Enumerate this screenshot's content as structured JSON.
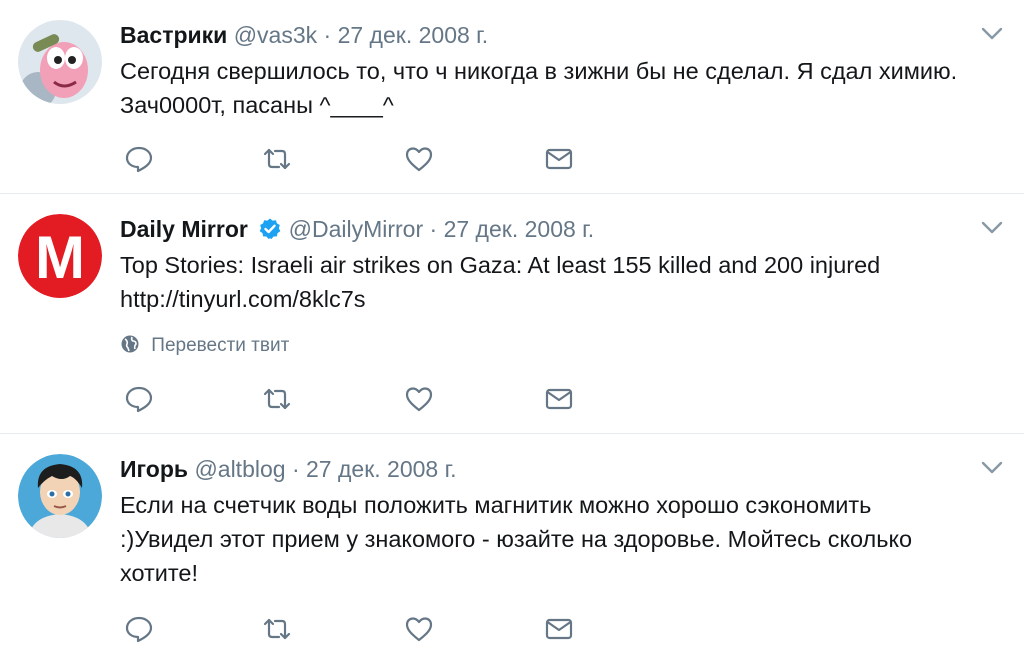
{
  "tweets": [
    {
      "name": "Вастрики",
      "handle": "@vas3k",
      "separator": "·",
      "date": "27 дек. 2008 г.",
      "text": "Сегодня свершилось то, что ч никогда в зижни бы не сделал. Я сдал химию. Зач0000т, пасаны ^____^",
      "avatar_icon": "cartoon-worm-avatar"
    },
    {
      "name": "Daily Mirror",
      "verified": true,
      "handle": "@DailyMirror",
      "separator": "·",
      "date": "27 дек. 2008 г.",
      "text": "Top Stories: Israeli air strikes on Gaza: At least 155 killed and 200 injured http://tinyurl.com/8klc7s",
      "translate_label": "Перевести твит",
      "avatar_icon": "daily-mirror-logo",
      "avatar_letter": "M"
    },
    {
      "name": "Игорь",
      "handle": "@altblog",
      "separator": "·",
      "date": "27 дек. 2008 г.",
      "text": "Если на счетчик воды положить магнитик можно хорошо сэкономить :)Увидел этот прием у знакомого - юзайте на здоровье. Мойтесь сколько хотите!",
      "avatar_icon": "cartoon-man-avatar"
    }
  ],
  "colors": {
    "text": "#14171a",
    "secondary": "#657786",
    "verified": "#1da1f2",
    "mirror_red": "#e31b23",
    "divider": "#e6ecf0"
  },
  "icons": [
    "reply-icon",
    "retweet-icon",
    "like-icon",
    "direct-message-icon",
    "chevron-down-icon",
    "globe-icon",
    "verified-badge-icon"
  ]
}
